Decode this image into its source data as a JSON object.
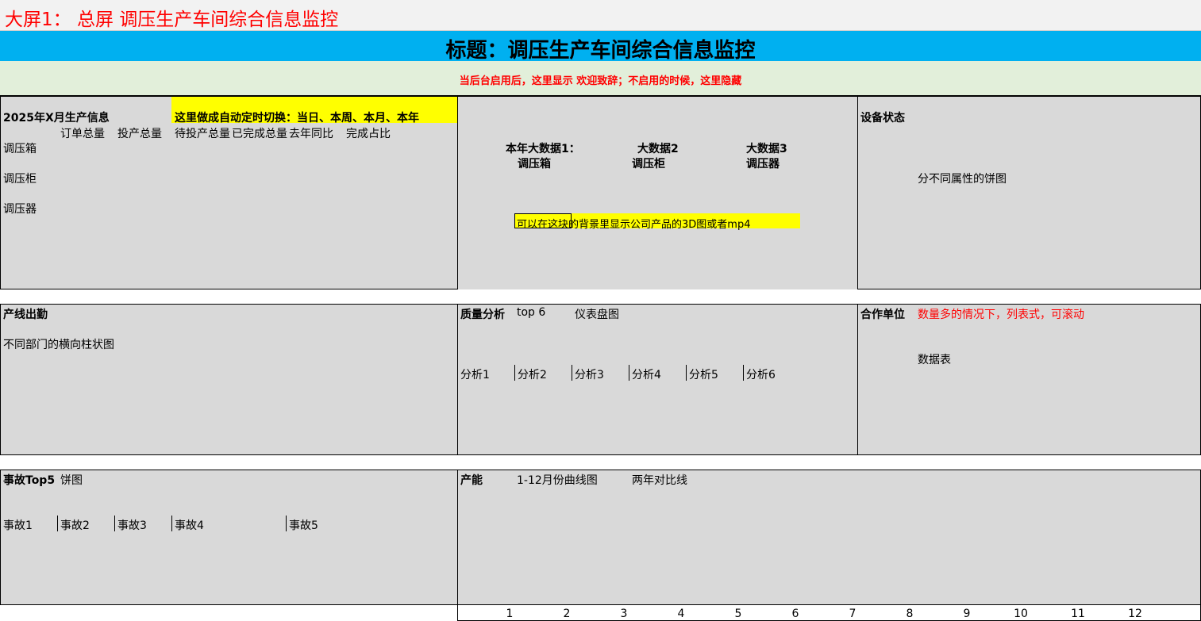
{
  "sheet": {
    "top_label": "大屏1：  总屏 调压生产车间综合信息监控"
  },
  "banner": {
    "title": "标题：调压生产车间综合信息监控"
  },
  "welcome": {
    "text": "当后台启用后，这里显示 欢迎致辞；不启用的时候，这里隐藏"
  },
  "production": {
    "title": "2025年X月生产信息",
    "note": "这里做成自动定时切换：当日、本周、本月、本年",
    "columns": [
      "订单总量",
      "投产总量",
      "待投产总量",
      "已完成总量",
      "去年同比",
      "完成占比"
    ],
    "rows": [
      "调压箱",
      "调压柜",
      "调压器"
    ]
  },
  "center": {
    "items": [
      {
        "title": "本年大数据1：",
        "sub": "调压箱"
      },
      {
        "title": "大数据2",
        "sub": "调压柜"
      },
      {
        "title": "大数据3",
        "sub": "调压器"
      }
    ],
    "note": "可以在这块的背景里显示公司产品的3D图或者mp4"
  },
  "device": {
    "title": "设备状态",
    "desc": "分不同属性的饼图"
  },
  "attendance": {
    "title": "产线出勤",
    "desc": "不同部门的横向柱状图"
  },
  "quality": {
    "title": "质量分析",
    "top": "top 6",
    "chart": "仪表盘图",
    "items": [
      "分析1",
      "分析2",
      "分析3",
      "分析4",
      "分析5",
      "分析6"
    ]
  },
  "partners": {
    "title": "合作单位",
    "note": "数量多的情况下，列表式，可滚动",
    "desc": "数据表"
  },
  "accidents": {
    "title": "事故Top5",
    "chart": "饼图",
    "items": [
      "事故1",
      "事故2",
      "事故3",
      "事故4",
      "事故5"
    ]
  },
  "capacity": {
    "title": "产能",
    "desc1": "1-12月份曲线图",
    "desc2": "两年对比线",
    "months": [
      "1",
      "2",
      "3",
      "4",
      "5",
      "6",
      "7",
      "8",
      "9",
      "10",
      "11",
      "12"
    ]
  },
  "colors": {
    "banner": "#00b0f0",
    "welcome_bg": "#e2efda",
    "highlight": "#ffff00",
    "panel": "#d9d9d9",
    "alert": "#ff0000"
  }
}
